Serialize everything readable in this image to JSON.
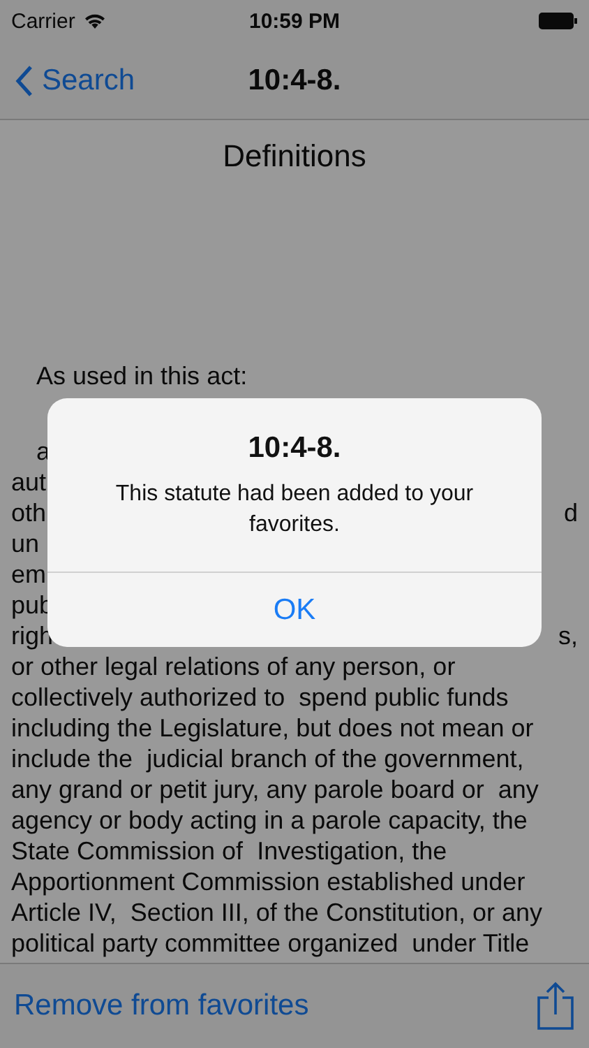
{
  "status_bar": {
    "carrier": "Carrier",
    "time": "10:59 PM"
  },
  "nav_bar": {
    "back_label": "Search",
    "title": "10:4-8."
  },
  "document": {
    "heading": "Definitions",
    "intro": "As used in this act:",
    "lines": [
      {
        "left": "a"
      },
      {
        "left": "aut"
      },
      {
        "left": "oth",
        "right": "d"
      },
      {
        "left": "un"
      },
      {
        "left": "em"
      },
      {
        "left": "pub"
      },
      {
        "left": "righ",
        "right": "s,"
      },
      {
        "left": "or other legal relations of any person, or"
      },
      {
        "left": "collectively authorized to  spend public funds"
      },
      {
        "left": "including the Legislature, but does not mean or"
      },
      {
        "left": "include the  judicial branch of the government,"
      },
      {
        "left": "any grand or petit jury, any parole board or  any"
      },
      {
        "left": "agency or body acting in a parole capacity, the"
      },
      {
        "left": "State Commission of  Investigation, the"
      },
      {
        "left": "Apportionment Commission established under"
      },
      {
        "left": "Article IV,  Section III, of the Constitution, or any"
      },
      {
        "left": "political party committee organized  under Title"
      }
    ]
  },
  "toolbar": {
    "action": "Remove from favorites"
  },
  "alert": {
    "title": "10:4-8.",
    "message": "This statute had been added to your favorites.",
    "button": "OK"
  }
}
